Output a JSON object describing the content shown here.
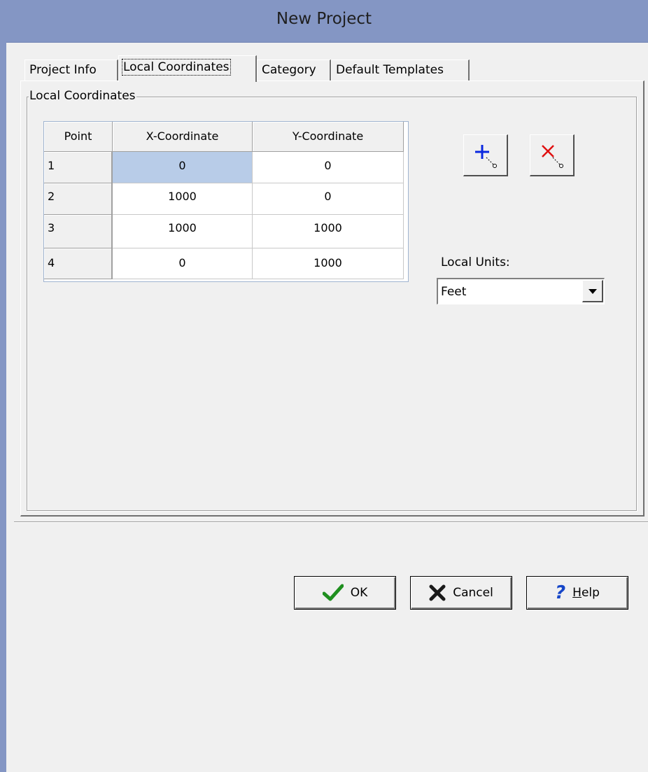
{
  "window": {
    "title": "New Project"
  },
  "tabs": [
    {
      "label": "Project Info"
    },
    {
      "label": "Local Coordinates"
    },
    {
      "label": "Category"
    },
    {
      "label": "Default Templates"
    }
  ],
  "group": {
    "label": "Local Coordinates"
  },
  "grid": {
    "headers": [
      "Point",
      "X-Coordinate",
      "Y-Coordinate"
    ],
    "rows": [
      {
        "point": "1",
        "x": "0",
        "y": "0"
      },
      {
        "point": "2",
        "x": "1000",
        "y": "0"
      },
      {
        "point": "3",
        "x": "1000",
        "y": "1000"
      },
      {
        "point": "4",
        "x": "0",
        "y": "1000"
      }
    ]
  },
  "tools": {
    "add_icon": "add-point-icon",
    "delete_icon": "delete-point-icon"
  },
  "units": {
    "label": "Local Units:",
    "value": "Feet"
  },
  "buttons": {
    "ok": {
      "label": "OK",
      "icon": "checkmark-icon"
    },
    "cancel": {
      "label": "Cancel",
      "icon": "x-icon"
    },
    "help": {
      "label_underlined": "H",
      "label_rest": "elp",
      "icon": "question-icon"
    }
  },
  "colors": {
    "titlebar": "#8496c4",
    "selected_cell": "#b8cce8",
    "ok_green": "#1f8f1f",
    "cancel_red": "#1a1a1a",
    "help_blue": "#1646c8"
  }
}
